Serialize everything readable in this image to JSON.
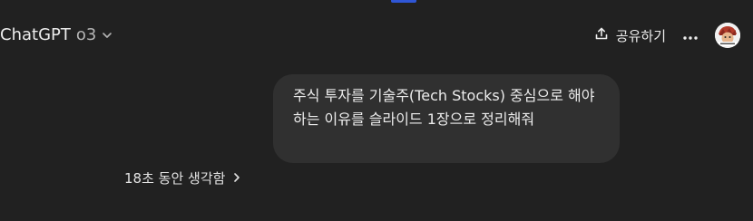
{
  "header": {
    "model_name": "ChatGPT",
    "model_version": "o3",
    "share_label": "공유하기"
  },
  "conversation": {
    "user_message": "주식 투자를 기술주(Tech Stocks) 중심으로 해야 하는 이유를 슬라이드 1장으로 정리해줘",
    "thinking_label": "18초 동안 생각함"
  },
  "icons": {
    "model_dropdown": "chevron-down-icon",
    "share": "share-upload-icon",
    "more": "more-horizontal-icon",
    "thinking_expand": "chevron-right-icon"
  },
  "colors": {
    "background": "#212121",
    "bubble": "#303030",
    "text": "#ececec",
    "accent": "#2f56d6"
  }
}
